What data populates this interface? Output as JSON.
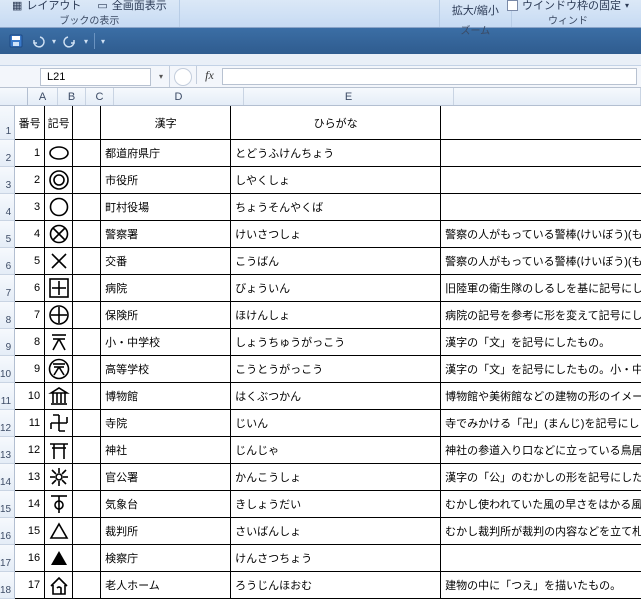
{
  "ribbon": {
    "layout_label": "レイアウト",
    "fullscreen_label": "全画面表示",
    "group1_caption": "ブックの表示",
    "zoom_label": "拡大/縮小",
    "zoom_caption": "ズーム",
    "freeze_panes_label": "ウインドウ枠の固定",
    "window_caption": "ウィンド"
  },
  "qat": {
    "save": "save-icon",
    "undo": "undo-icon",
    "redo": "redo-icon"
  },
  "namebox": {
    "value": "L21"
  },
  "formula": {
    "fx": "fx",
    "value": ""
  },
  "cols": {
    "A": "A",
    "B": "B",
    "C": "C",
    "D": "D",
    "E": "E"
  },
  "headers": {
    "num": "番号",
    "sym": "記号",
    "c": "",
    "kanji": "漢字",
    "hira": "ひらがな",
    "desc": ""
  },
  "rows": [
    {
      "n": "1",
      "sym": "oval",
      "kanji": "都道府県庁",
      "hira": "とどうふけんちょう",
      "desc": ""
    },
    {
      "n": "2",
      "sym": "dbl-circle",
      "kanji": "市役所",
      "hira": "しやくしょ",
      "desc": ""
    },
    {
      "n": "3",
      "sym": "circle",
      "kanji": "町村役場",
      "hira": "ちょうそんやくば",
      "desc": ""
    },
    {
      "n": "4",
      "sym": "circle-x",
      "kanji": "警察署",
      "hira": "けいさつしょ",
      "desc": "警察の人がもっている警棒(けいぼう)(も"
    },
    {
      "n": "5",
      "sym": "x",
      "kanji": "交番",
      "hira": "こうばん",
      "desc": "警察の人がもっている警棒(けいぼう)(も"
    },
    {
      "n": "6",
      "sym": "sq-cross",
      "kanji": "病院",
      "hira": "びょういん",
      "desc": "旧陸軍の衛生隊のしるしを基に記号にしま"
    },
    {
      "n": "7",
      "sym": "circ-cross",
      "kanji": "保険所",
      "hira": "ほけんしょ",
      "desc": "病院の記号を参考に形を変えて記号にしま"
    },
    {
      "n": "8",
      "sym": "mon",
      "kanji": "小・中学校",
      "hira": "しょうちゅうがっこう",
      "desc": "漢字の「文」を記号にしたもの。"
    },
    {
      "n": "9",
      "sym": "circ-mon",
      "kanji": "高等学校",
      "hira": "こうとうがっこう",
      "desc": "漢字の「文」を記号にしたもの。小・中学校"
    },
    {
      "n": "10",
      "sym": "museum",
      "kanji": "博物館",
      "hira": "はくぶつかん",
      "desc": "博物館や美術館などの建物の形のイメー"
    },
    {
      "n": "11",
      "sym": "swastika",
      "kanji": "寺院",
      "hira": "じいん",
      "desc": "寺でみかける「卍」(まんじ)を記号にしま"
    },
    {
      "n": "12",
      "sym": "torii",
      "kanji": "神社",
      "hira": "じんじゃ",
      "desc": "神社の参道入り口などに立っている鳥居"
    },
    {
      "n": "13",
      "sym": "star",
      "kanji": "官公署",
      "hira": "かんこうしょ",
      "desc": "漢字の「公」のむかしの形を記号にしたも"
    },
    {
      "n": "14",
      "sym": "weather",
      "kanji": "気象台",
      "hira": "きしょうだい",
      "desc": "むかし使われていた風の早さをはかる風"
    },
    {
      "n": "15",
      "sym": "tri-up",
      "kanji": "裁判所",
      "hira": "さいばんしょ",
      "desc": "むかし裁判所が裁判の内容などを立て札"
    },
    {
      "n": "16",
      "sym": "tri-solid",
      "kanji": "検察庁",
      "hira": "けんさつちょう",
      "desc": ""
    },
    {
      "n": "17",
      "sym": "home",
      "kanji": "老人ホーム",
      "hira": "ろうじんほおむ",
      "desc": "建物の中に「つえ」を描いたもの。"
    }
  ]
}
